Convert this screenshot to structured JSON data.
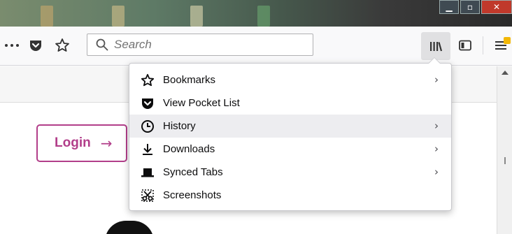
{
  "toolbar": {
    "more_icon": "ellipsis-icon",
    "pocket_icon": "pocket-icon",
    "bookmark_star_icon": "star-icon",
    "search": {
      "placeholder": "Search",
      "icon": "search-icon"
    },
    "library_icon": "library-icon",
    "sidebar_icon": "sidebar-icon",
    "menu_icon": "hamburger-menu-icon"
  },
  "page": {
    "login_label": "Login",
    "login_arrow": "→",
    "accent_color": "#b23e8a"
  },
  "library_menu": {
    "items": [
      {
        "label": "Bookmarks",
        "icon": "star-icon",
        "submenu": true
      },
      {
        "label": "View Pocket List",
        "icon": "pocket-icon",
        "submenu": false
      },
      {
        "label": "History",
        "icon": "clock-icon",
        "submenu": true,
        "highlighted": true
      },
      {
        "label": "Downloads",
        "icon": "download-icon",
        "submenu": true
      },
      {
        "label": "Synced Tabs",
        "icon": "synced-tabs-icon",
        "submenu": true
      },
      {
        "label": "Screenshots",
        "icon": "scissors-icon",
        "submenu": false
      }
    ],
    "chevron": "›"
  }
}
